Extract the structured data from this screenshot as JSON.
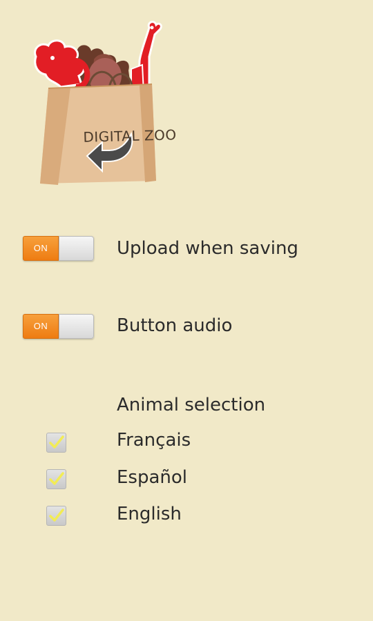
{
  "app": {
    "logo_text": "DIGITAL ZOO",
    "logo_icon": "back-arrow-icon"
  },
  "settings": {
    "upload_toggle": {
      "state_label": "ON",
      "label": "Upload when saving",
      "on": true
    },
    "audio_toggle": {
      "state_label": "ON",
      "label": "Button audio",
      "on": true
    },
    "animal_selection": {
      "heading": "Animal selection",
      "options": [
        {
          "label": "Français",
          "checked": true
        },
        {
          "label": "Español",
          "checked": true
        },
        {
          "label": "English",
          "checked": true
        }
      ]
    }
  },
  "colors": {
    "background": "#f1e9c8",
    "toggle_on": "#ee7c12",
    "bag": "#e3bf96",
    "check": "#f2ec55"
  }
}
